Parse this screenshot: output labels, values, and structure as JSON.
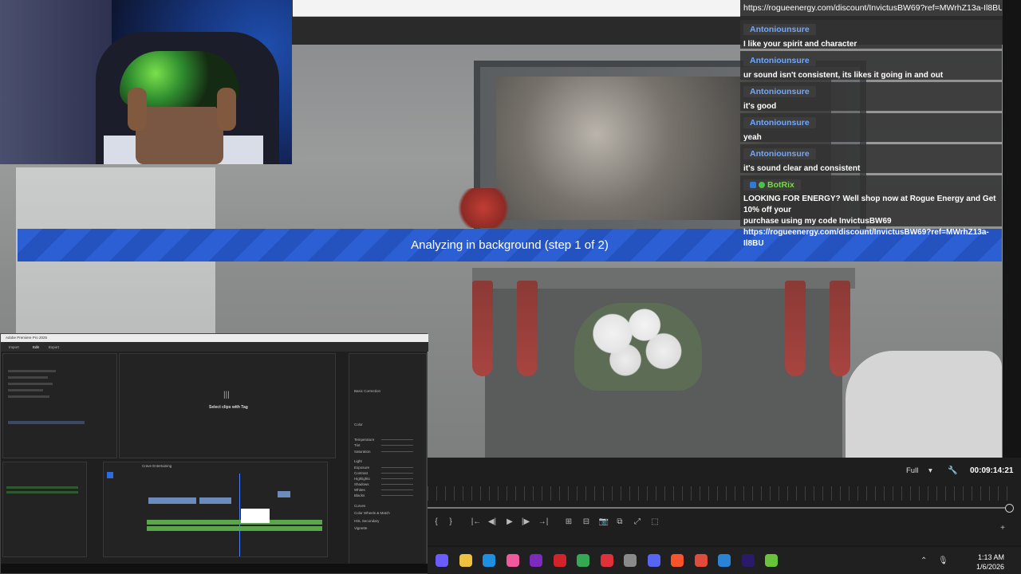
{
  "banner": {
    "text": "Analyzing in background (step 1 of 2)"
  },
  "chat": {
    "top_url": "https://rogueenergy.com/discount/InvictusBW69?ref=MWrhZ13a-Il8BU",
    "messages": [
      {
        "user": "Antoniounsure",
        "text": "I like your spirit and character"
      },
      {
        "user": "Antoniounsure",
        "text": "ur sound isn't consistent, its likes it going in and out"
      },
      {
        "user": "Antoniounsure",
        "text": "it's good"
      },
      {
        "user": "Antoniounsure",
        "text": "yeah"
      },
      {
        "user": "Antoniounsure",
        "text": "it's sound clear and consistent"
      }
    ],
    "bot_message": {
      "user": "BotRix",
      "text_line1": "LOOKING FOR ENERGY? Well shop now at Rogue Energy and Get 10% off your",
      "text_line2": "purchase using my code InvictusBW69",
      "text_line3": "https://rogueenergy.com/discount/InvictusBW69?ref=MWrhZ13a-Il8BU"
    }
  },
  "monitor": {
    "resolution": "Full",
    "resolution_caret": "▾",
    "timecode": "00:09:14:21",
    "wrench_icon": "🔧",
    "buttons": [
      "{",
      "}",
      "|←",
      "◀|",
      "▶",
      "|▶",
      "→|",
      "⊞",
      "⊟",
      "📷",
      "⧉",
      "⤢",
      "⬚"
    ],
    "add_button": "+"
  },
  "premiere": {
    "title": "Adobe Premiere Pro 2025",
    "panel_caption": "Select clips with Tag",
    "sequence_tab": "Crave Entertaining",
    "workspace_tabs": [
      "Import",
      "Edit",
      "Export"
    ],
    "effect_section_labels": [
      "Basic Correction",
      "Color",
      "Light",
      "Temperature",
      "Tint",
      "Saturation",
      "Exposure",
      "Contrast",
      "Highlights",
      "Shadows",
      "Whites",
      "Blacks",
      "Curves",
      "Color Wheels & Match",
      "HSL Secondary",
      "Vignette"
    ]
  },
  "taskbar": {
    "time": "1:13 AM",
    "date": "1/6/2026",
    "apps": [
      {
        "name": "copilot-icon",
        "color": "#6a5cff"
      },
      {
        "name": "folder-icon",
        "color": "#f0c040"
      },
      {
        "name": "edge-icon",
        "color": "#1f8fe0"
      },
      {
        "name": "paint-icon",
        "color": "#f05a9a"
      },
      {
        "name": "nzxt-icon",
        "color": "#7b2cbf"
      },
      {
        "name": "opera-icon",
        "color": "#d2232a"
      },
      {
        "name": "chrome-icon",
        "color": "#34a853"
      },
      {
        "name": "voicemod-icon",
        "color": "#e0303a"
      },
      {
        "name": "settings-icon",
        "color": "#8a8a8a"
      },
      {
        "name": "discord-icon",
        "color": "#5865f2"
      },
      {
        "name": "brave-icon",
        "color": "#fb542b"
      },
      {
        "name": "obs-icon",
        "color": "#e14b3b"
      },
      {
        "name": "photos-icon",
        "color": "#2a84d6"
      },
      {
        "name": "premiere-icon",
        "color": "#2a1a6a"
      },
      {
        "name": "xbox-icon",
        "color": "#69c23a"
      }
    ]
  }
}
